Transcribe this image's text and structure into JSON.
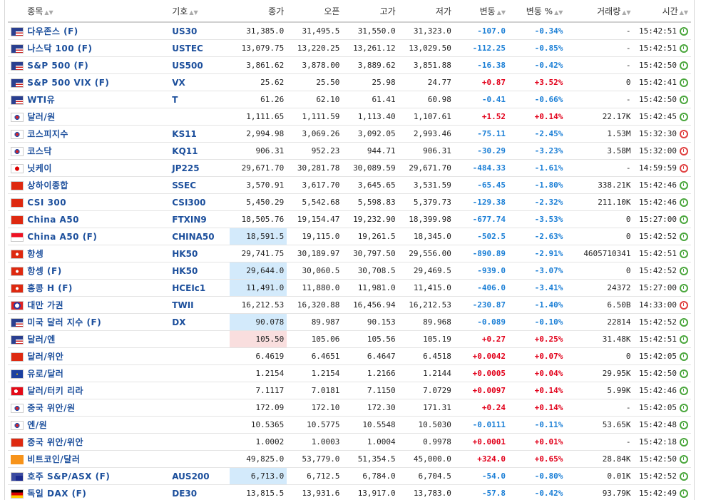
{
  "headers": {
    "name": "종목",
    "symbol": "기호",
    "last": "종가",
    "open": "오픈",
    "high": "고가",
    "low": "저가",
    "change": "변동",
    "change_pct": "변동 %",
    "volume": "거래량",
    "time": "시간"
  },
  "colors": {
    "up": "#e2001a",
    "down": "#1b7fd6",
    "link": "#1c4f9c",
    "clock_open": "#4aa63c",
    "clock_closed": "#e04040"
  },
  "rows": [
    {
      "flag": "us",
      "name": "다우존스 (F)",
      "symbol": "US30",
      "last": "31,385.0",
      "open": "31,495.5",
      "high": "31,550.0",
      "low": "31,323.0",
      "chg": "-107.0",
      "pct": "-0.34%",
      "dir": "dn",
      "vol": "-",
      "time": "15:42:51",
      "status": "open",
      "hl": ""
    },
    {
      "flag": "us",
      "name": "나스닥 100 (F)",
      "symbol": "USTEC",
      "last": "13,079.75",
      "open": "13,220.25",
      "high": "13,261.12",
      "low": "13,029.50",
      "chg": "-112.25",
      "pct": "-0.85%",
      "dir": "dn",
      "vol": "-",
      "time": "15:42:51",
      "status": "open",
      "hl": ""
    },
    {
      "flag": "us",
      "name": "S&P 500 (F)",
      "symbol": "US500",
      "last": "3,861.62",
      "open": "3,878.00",
      "high": "3,889.62",
      "low": "3,851.88",
      "chg": "-16.38",
      "pct": "-0.42%",
      "dir": "dn",
      "vol": "-",
      "time": "15:42:50",
      "status": "open",
      "hl": ""
    },
    {
      "flag": "us",
      "name": "S&P 500 VIX (F)",
      "symbol": "VX",
      "last": "25.62",
      "open": "25.50",
      "high": "25.98",
      "low": "24.77",
      "chg": "+0.87",
      "pct": "+3.52%",
      "dir": "up",
      "vol": "0",
      "time": "15:42:41",
      "status": "open",
      "hl": ""
    },
    {
      "flag": "us",
      "name": "WTI유",
      "symbol": "T",
      "last": "61.26",
      "open": "62.10",
      "high": "61.41",
      "low": "60.98",
      "chg": "-0.41",
      "pct": "-0.66%",
      "dir": "dn",
      "vol": "-",
      "time": "15:42:50",
      "status": "open",
      "hl": ""
    },
    {
      "flag": "kr",
      "name": "달러/원",
      "symbol": "",
      "last": "1,111.65",
      "open": "1,111.59",
      "high": "1,113.40",
      "low": "1,107.61",
      "chg": "+1.52",
      "pct": "+0.14%",
      "dir": "up",
      "vol": "22.17K",
      "time": "15:42:45",
      "status": "open",
      "hl": ""
    },
    {
      "flag": "kr",
      "name": "코스피지수",
      "symbol": "KS11",
      "last": "2,994.98",
      "open": "3,069.26",
      "high": "3,092.05",
      "low": "2,993.46",
      "chg": "-75.11",
      "pct": "-2.45%",
      "dir": "dn",
      "vol": "1.53M",
      "time": "15:32:30",
      "status": "closed",
      "hl": ""
    },
    {
      "flag": "kr",
      "name": "코스닥",
      "symbol": "KQ11",
      "last": "906.31",
      "open": "952.23",
      "high": "944.71",
      "low": "906.31",
      "chg": "-30.29",
      "pct": "-3.23%",
      "dir": "dn",
      "vol": "3.58M",
      "time": "15:32:00",
      "status": "closed",
      "hl": ""
    },
    {
      "flag": "jp",
      "name": "닛케이",
      "symbol": "JP225",
      "last": "29,671.70",
      "open": "30,281.78",
      "high": "30,089.59",
      "low": "29,671.70",
      "chg": "-484.33",
      "pct": "-1.61%",
      "dir": "dn",
      "vol": "-",
      "time": "14:59:59",
      "status": "closed",
      "hl": ""
    },
    {
      "flag": "cn",
      "name": "상하이종합",
      "symbol": "SSEC",
      "last": "3,570.91",
      "open": "3,617.70",
      "high": "3,645.65",
      "low": "3,531.59",
      "chg": "-65.45",
      "pct": "-1.80%",
      "dir": "dn",
      "vol": "338.21K",
      "time": "15:42:46",
      "status": "open",
      "hl": ""
    },
    {
      "flag": "cn",
      "name": "CSI 300",
      "symbol": "CSI300",
      "last": "5,450.29",
      "open": "5,542.68",
      "high": "5,598.83",
      "low": "5,379.73",
      "chg": "-129.38",
      "pct": "-2.32%",
      "dir": "dn",
      "vol": "211.10K",
      "time": "15:42:46",
      "status": "open",
      "hl": ""
    },
    {
      "flag": "cn",
      "name": "China A50",
      "symbol": "FTXIN9",
      "last": "18,505.76",
      "open": "19,154.47",
      "high": "19,232.90",
      "low": "18,399.98",
      "chg": "-677.74",
      "pct": "-3.53%",
      "dir": "dn",
      "vol": "0",
      "time": "15:27:00",
      "status": "open",
      "hl": ""
    },
    {
      "flag": "sg",
      "name": "China A50 (F)",
      "symbol": "CHINA50",
      "last": "18,591.5",
      "open": "19,115.0",
      "high": "19,261.5",
      "low": "18,345.0",
      "chg": "-502.5",
      "pct": "-2.63%",
      "dir": "dn",
      "vol": "0",
      "time": "15:42:52",
      "status": "open",
      "hl": "dn"
    },
    {
      "flag": "hk",
      "name": "항셍",
      "symbol": "HK50",
      "last": "29,741.75",
      "open": "30,189.97",
      "high": "30,797.50",
      "low": "29,556.00",
      "chg": "-890.89",
      "pct": "-2.91%",
      "dir": "dn",
      "vol": "4605710341",
      "time": "15:42:51",
      "status": "open",
      "hl": ""
    },
    {
      "flag": "hk",
      "name": "항셍 (F)",
      "symbol": "HK50",
      "last": "29,644.0",
      "open": "30,060.5",
      "high": "30,708.5",
      "low": "29,469.5",
      "chg": "-939.0",
      "pct": "-3.07%",
      "dir": "dn",
      "vol": "0",
      "time": "15:42:52",
      "status": "open",
      "hl": "dn"
    },
    {
      "flag": "hk",
      "name": "홍콩 H (F)",
      "symbol": "HCEIc1",
      "last": "11,491.0",
      "open": "11,880.0",
      "high": "11,981.0",
      "low": "11,415.0",
      "chg": "-406.0",
      "pct": "-3.41%",
      "dir": "dn",
      "vol": "24372",
      "time": "15:27:00",
      "status": "open",
      "hl": "dn"
    },
    {
      "flag": "tw",
      "name": "대만 가권",
      "symbol": "TWII",
      "last": "16,212.53",
      "open": "16,320.88",
      "high": "16,456.94",
      "low": "16,212.53",
      "chg": "-230.87",
      "pct": "-1.40%",
      "dir": "dn",
      "vol": "6.50B",
      "time": "14:33:00",
      "status": "closed",
      "hl": ""
    },
    {
      "flag": "us",
      "name": "미국 달러 지수 (F)",
      "symbol": "DX",
      "last": "90.078",
      "open": "89.987",
      "high": "90.153",
      "low": "89.968",
      "chg": "-0.089",
      "pct": "-0.10%",
      "dir": "dn",
      "vol": "22814",
      "time": "15:42:52",
      "status": "open",
      "hl": "dn"
    },
    {
      "flag": "us",
      "name": "달러/엔",
      "symbol": "",
      "last": "105.50",
      "open": "105.06",
      "high": "105.56",
      "low": "105.19",
      "chg": "+0.27",
      "pct": "+0.25%",
      "dir": "up",
      "vol": "31.48K",
      "time": "15:42:51",
      "status": "open",
      "hl": "up"
    },
    {
      "flag": "cn",
      "name": "달러/위안",
      "symbol": "",
      "last": "6.4619",
      "open": "6.4651",
      "high": "6.4647",
      "low": "6.4518",
      "chg": "+0.0042",
      "pct": "+0.07%",
      "dir": "up",
      "vol": "0",
      "time": "15:42:05",
      "status": "open",
      "hl": ""
    },
    {
      "flag": "eu",
      "name": "유로/달러",
      "symbol": "",
      "last": "1.2154",
      "open": "1.2154",
      "high": "1.2166",
      "low": "1.2144",
      "chg": "+0.0005",
      "pct": "+0.04%",
      "dir": "up",
      "vol": "29.95K",
      "time": "15:42:50",
      "status": "open",
      "hl": ""
    },
    {
      "flag": "tr",
      "name": "달러/터키 리라",
      "symbol": "",
      "last": "7.1117",
      "open": "7.0181",
      "high": "7.1150",
      "low": "7.0729",
      "chg": "+0.0097",
      "pct": "+0.14%",
      "dir": "up",
      "vol": "5.99K",
      "time": "15:42:46",
      "status": "open",
      "hl": ""
    },
    {
      "flag": "kr",
      "name": "중국 위안/원",
      "symbol": "",
      "last": "172.09",
      "open": "172.10",
      "high": "172.30",
      "low": "171.31",
      "chg": "+0.24",
      "pct": "+0.14%",
      "dir": "up",
      "vol": "-",
      "time": "15:42:05",
      "status": "open",
      "hl": ""
    },
    {
      "flag": "kr",
      "name": "엔/원",
      "symbol": "",
      "last": "10.5365",
      "open": "10.5775",
      "high": "10.5548",
      "low": "10.5030",
      "chg": "-0.0111",
      "pct": "-0.11%",
      "dir": "dn",
      "vol": "53.65K",
      "time": "15:42:48",
      "status": "open",
      "hl": ""
    },
    {
      "flag": "cn",
      "name": "중국 위안/위안",
      "symbol": "",
      "last": "1.0002",
      "open": "1.0003",
      "high": "1.0004",
      "low": "0.9978",
      "chg": "+0.0001",
      "pct": "+0.01%",
      "dir": "up",
      "vol": "-",
      "time": "15:42:18",
      "status": "open",
      "hl": ""
    },
    {
      "flag": "btc",
      "name": "비트코인/달러",
      "symbol": "",
      "last": "49,825.0",
      "open": "53,779.0",
      "high": "51,354.5",
      "low": "45,000.0",
      "chg": "+324.0",
      "pct": "+0.65%",
      "dir": "up",
      "vol": "28.84K",
      "time": "15:42:50",
      "status": "open",
      "hl": ""
    },
    {
      "flag": "au",
      "name": "호주 S&P/ASX (F)",
      "symbol": "AUS200",
      "last": "6,713.0",
      "open": "6,712.5",
      "high": "6,784.0",
      "low": "6,704.5",
      "chg": "-54.0",
      "pct": "-0.80%",
      "dir": "dn",
      "vol": "0.01K",
      "time": "15:42:52",
      "status": "open",
      "hl": "dn"
    },
    {
      "flag": "de",
      "name": "독일 DAX (F)",
      "symbol": "DE30",
      "last": "13,815.5",
      "open": "13,931.6",
      "high": "13,917.0",
      "low": "13,783.0",
      "chg": "-57.8",
      "pct": "-0.42%",
      "dir": "dn",
      "vol": "93.79K",
      "time": "15:42:49",
      "status": "open",
      "hl": ""
    }
  ]
}
